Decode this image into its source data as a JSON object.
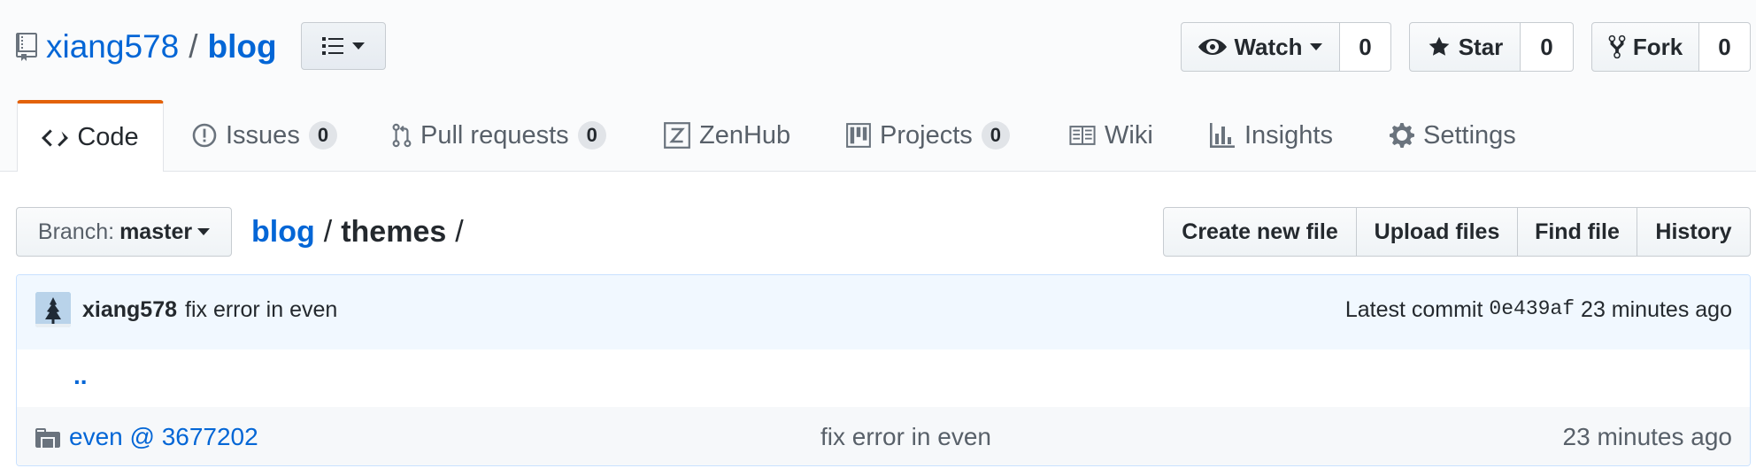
{
  "repo": {
    "owner": "xiang578",
    "separator": "/",
    "name": "blog"
  },
  "social": {
    "watch": {
      "label": "Watch",
      "count": "0"
    },
    "star": {
      "label": "Star",
      "count": "0"
    },
    "fork": {
      "label": "Fork",
      "count": "0"
    }
  },
  "tabs": [
    {
      "label": "Code",
      "icon": "code-icon",
      "selected": true
    },
    {
      "label": "Issues",
      "badge": "0",
      "icon": "issue-icon"
    },
    {
      "label": "Pull requests",
      "badge": "0",
      "icon": "pull-request-icon"
    },
    {
      "label": "ZenHub",
      "icon": "zenhub-icon"
    },
    {
      "label": "Projects",
      "badge": "0",
      "icon": "project-icon"
    },
    {
      "label": "Wiki",
      "icon": "book-icon"
    },
    {
      "label": "Insights",
      "icon": "graph-icon"
    },
    {
      "label": "Settings",
      "icon": "gear-icon"
    }
  ],
  "branch": {
    "label": "Branch:",
    "value": "master"
  },
  "breadcrumb": {
    "repo": "blog",
    "sep1": "/",
    "current": "themes",
    "sep2": "/"
  },
  "actions": [
    "Create new file",
    "Upload files",
    "Find file",
    "History"
  ],
  "commit": {
    "author": "xiang578",
    "message": "fix error in even",
    "latest_label": "Latest commit",
    "sha": "0e439af",
    "age": "23 minutes ago"
  },
  "parent_link": "..",
  "files": [
    {
      "name": "even @ 3677202",
      "message": "fix error in even",
      "age": "23 minutes ago",
      "icon": "submodule-icon"
    }
  ],
  "colors": {
    "link": "#0366d6",
    "tab_accent": "#e36209",
    "commit_bg": "#f1f8ff"
  }
}
